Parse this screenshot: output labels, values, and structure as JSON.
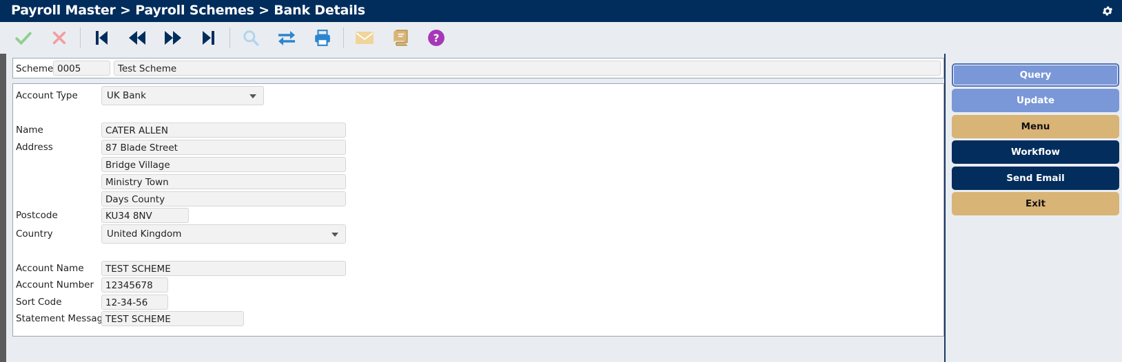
{
  "header": {
    "breadcrumb": "Payroll Master > Payroll Schemes > Bank Details",
    "settings_icon": "gear-icon"
  },
  "toolbar": {
    "buttons": [
      {
        "name": "confirm",
        "icon": "checkmark-icon",
        "color": "#8fd08f"
      },
      {
        "name": "cancel",
        "icon": "close-icon",
        "color": "#f0a0a0"
      },
      {
        "name": "first-record",
        "icon": "skip-first-icon",
        "color": "#012d5c"
      },
      {
        "name": "previous-record",
        "icon": "rewind-icon",
        "color": "#012d5c"
      },
      {
        "name": "next-record",
        "icon": "fast-forward-icon",
        "color": "#012d5c"
      },
      {
        "name": "last-record",
        "icon": "skip-last-icon",
        "color": "#012d5c"
      },
      {
        "name": "search",
        "icon": "search-icon",
        "color": "#b3d4ee"
      },
      {
        "name": "swap",
        "icon": "swap-arrows-icon",
        "color": "#2b86d0"
      },
      {
        "name": "print",
        "icon": "printer-icon",
        "color": "#2b86d0"
      },
      {
        "name": "email",
        "icon": "envelope-icon",
        "color": "#f0d49a"
      },
      {
        "name": "notes",
        "icon": "book-icon",
        "color": "#d9b477"
      },
      {
        "name": "help",
        "icon": "help-icon",
        "color": "#a638b8"
      }
    ]
  },
  "scheme": {
    "label": "Scheme",
    "code": "0005",
    "name": "Test Scheme"
  },
  "form": {
    "account_type_label": "Account Type",
    "account_type_value": "UK Bank",
    "name_label": "Name",
    "name_value": "CATER ALLEN",
    "address_label": "Address",
    "address_lines": [
      "87 Blade Street",
      "Bridge Village",
      "Ministry Town",
      "Days County"
    ],
    "postcode_label": "Postcode",
    "postcode_value": "KU34 8NV",
    "country_label": "Country",
    "country_value": "United Kingdom",
    "account_name_label": "Account Name",
    "account_name_value": "TEST SCHEME",
    "account_number_label": "Account Number",
    "account_number_value": "12345678",
    "sort_code_label": "Sort Code",
    "sort_code_value": "12-34-56",
    "statement_message_label": "Statement Message",
    "statement_message_value": "TEST SCHEME"
  },
  "actions": {
    "query": "Query",
    "update": "Update",
    "menu": "Menu",
    "workflow": "Workflow",
    "send_email": "Send Email",
    "exit": "Exit"
  },
  "colors": {
    "header_navy": "#012d5c",
    "action_blue": "#7a98d8",
    "action_tan": "#d9b477"
  }
}
